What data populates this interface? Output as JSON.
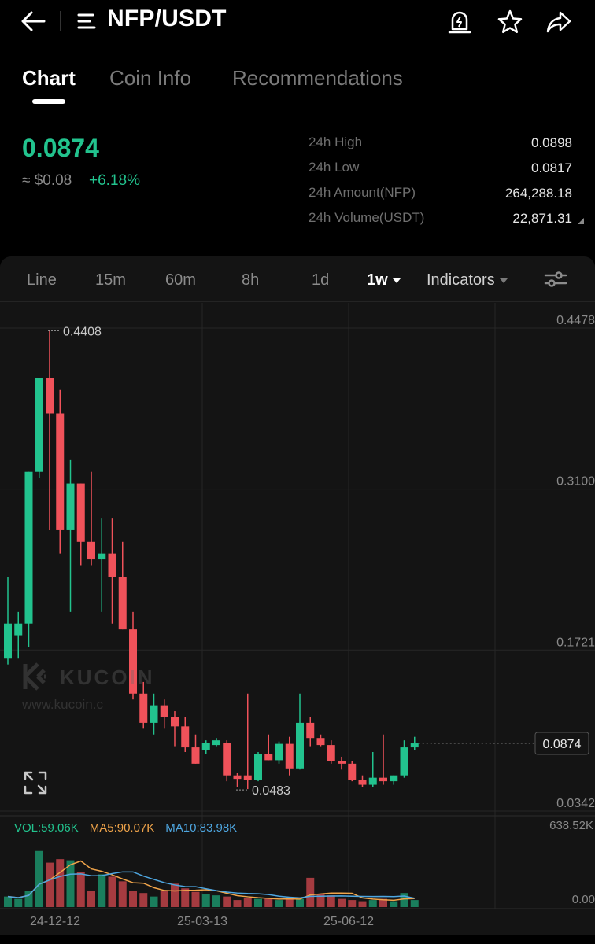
{
  "header": {
    "title": "NFP/USDT",
    "icons": [
      "back-arrow-icon",
      "menu-lines-icon",
      "price-alert-icon",
      "star-icon",
      "share-icon"
    ]
  },
  "tabs": [
    {
      "label": "Chart",
      "active": true
    },
    {
      "label": "Coin Info",
      "active": false
    },
    {
      "label": "Recommendations",
      "active": false
    }
  ],
  "ticker": {
    "last_price": "0.0874",
    "usd_approx": "≈ $0.08",
    "change_pct": "+6.18%",
    "stats": [
      {
        "label": "24h High",
        "value": "0.0898"
      },
      {
        "label": "24h Low",
        "value": "0.0817"
      },
      {
        "label": "24h Amount(NFP)",
        "value": "264,288.18"
      },
      {
        "label": "24h Volume(USDT)",
        "value": "22,871.31"
      }
    ]
  },
  "intervals": {
    "line": "Line",
    "m15": "15m",
    "m60": "60m",
    "h8": "8h",
    "d1": "1d",
    "w1": "1w",
    "indicators": "Indicators",
    "selected": "1w"
  },
  "colors": {
    "up": "#22c38e",
    "down": "#f0525a",
    "ma5": "#f0a44a",
    "ma10": "#4ea6e0",
    "background": "#141414"
  },
  "watermark": {
    "brand": "KUCOIN",
    "url": "www.kucoin.c"
  },
  "indicators": {
    "vol": "VOL:59.06K",
    "ma5": "MA5:90.07K",
    "ma10": "MA10:83.98K"
  },
  "chart_data": {
    "type": "candlestick",
    "y_axis_labels": [
      "0.4478",
      "0.3100",
      "0.1721",
      "0.0342"
    ],
    "y_ticks": [
      0.4478,
      0.31,
      0.1721,
      0.0342
    ],
    "volume_axis_labels": [
      "638.52K",
      "0.00"
    ],
    "x_axis_labels": [
      "24-12-12",
      "25-03-13",
      "25-06-12"
    ],
    "max_marker": "0.4408",
    "min_marker": "0.0483",
    "last_price_label": "0.0874",
    "last_price": 0.0874,
    "candles": [
      {
        "o": 0.16,
        "h": 0.23,
        "l": 0.155,
        "c": 0.19
      },
      {
        "o": 0.18,
        "h": 0.2,
        "l": 0.16,
        "c": 0.19
      },
      {
        "o": 0.19,
        "h": 0.29,
        "l": 0.17,
        "c": 0.32
      },
      {
        "o": 0.32,
        "h": 0.39,
        "l": 0.315,
        "c": 0.4
      },
      {
        "o": 0.4,
        "h": 0.4408,
        "l": 0.27,
        "c": 0.37
      },
      {
        "o": 0.37,
        "h": 0.39,
        "l": 0.25,
        "c": 0.27
      },
      {
        "o": 0.27,
        "h": 0.33,
        "l": 0.2,
        "c": 0.31
      },
      {
        "o": 0.31,
        "h": 0.31,
        "l": 0.24,
        "c": 0.26
      },
      {
        "o": 0.26,
        "h": 0.32,
        "l": 0.24,
        "c": 0.245
      },
      {
        "o": 0.245,
        "h": 0.28,
        "l": 0.2,
        "c": 0.25
      },
      {
        "o": 0.25,
        "h": 0.28,
        "l": 0.19,
        "c": 0.23
      },
      {
        "o": 0.23,
        "h": 0.26,
        "l": 0.19,
        "c": 0.185
      },
      {
        "o": 0.185,
        "h": 0.2,
        "l": 0.125,
        "c": 0.13
      },
      {
        "o": 0.13,
        "h": 0.14,
        "l": 0.1,
        "c": 0.105
      },
      {
        "o": 0.105,
        "h": 0.13,
        "l": 0.095,
        "c": 0.12
      },
      {
        "o": 0.12,
        "h": 0.125,
        "l": 0.1,
        "c": 0.11
      },
      {
        "o": 0.11,
        "h": 0.115,
        "l": 0.085,
        "c": 0.102
      },
      {
        "o": 0.102,
        "h": 0.11,
        "l": 0.08,
        "c": 0.084
      },
      {
        "o": 0.084,
        "h": 0.095,
        "l": 0.072,
        "c": 0.07
      },
      {
        "o": 0.082,
        "h": 0.09,
        "l": 0.078,
        "c": 0.088
      },
      {
        "o": 0.086,
        "h": 0.092,
        "l": 0.085,
        "c": 0.09
      },
      {
        "o": 0.088,
        "h": 0.09,
        "l": 0.055,
        "c": 0.06
      },
      {
        "o": 0.06,
        "h": 0.062,
        "l": 0.05,
        "c": 0.057
      },
      {
        "o": 0.06,
        "h": 0.13,
        "l": 0.0483,
        "c": 0.056
      },
      {
        "o": 0.056,
        "h": 0.08,
        "l": 0.055,
        "c": 0.078
      },
      {
        "o": 0.078,
        "h": 0.095,
        "l": 0.075,
        "c": 0.073
      },
      {
        "o": 0.073,
        "h": 0.089,
        "l": 0.07,
        "c": 0.087
      },
      {
        "o": 0.087,
        "h": 0.093,
        "l": 0.06,
        "c": 0.066
      },
      {
        "o": 0.066,
        "h": 0.13,
        "l": 0.065,
        "c": 0.105
      },
      {
        "o": 0.105,
        "h": 0.11,
        "l": 0.085,
        "c": 0.092
      },
      {
        "o": 0.092,
        "h": 0.095,
        "l": 0.085,
        "c": 0.086
      },
      {
        "o": 0.086,
        "h": 0.09,
        "l": 0.07,
        "c": 0.072
      },
      {
        "o": 0.072,
        "h": 0.076,
        "l": 0.065,
        "c": 0.07
      },
      {
        "o": 0.07,
        "h": 0.072,
        "l": 0.055,
        "c": 0.056
      },
      {
        "o": 0.056,
        "h": 0.06,
        "l": 0.05,
        "c": 0.052
      },
      {
        "o": 0.052,
        "h": 0.08,
        "l": 0.05,
        "c": 0.058
      },
      {
        "o": 0.058,
        "h": 0.095,
        "l": 0.052,
        "c": 0.055
      },
      {
        "o": 0.055,
        "h": 0.06,
        "l": 0.052,
        "c": 0.06
      },
      {
        "o": 0.06,
        "h": 0.09,
        "l": 0.058,
        "c": 0.084
      },
      {
        "o": 0.084,
        "h": 0.093,
        "l": 0.082,
        "c": 0.0874
      }
    ],
    "volumes": [
      0.09,
      0.07,
      0.14,
      0.48,
      0.38,
      0.41,
      0.4,
      0.3,
      0.14,
      0.28,
      0.26,
      0.22,
      0.14,
      0.12,
      0.09,
      0.14,
      0.2,
      0.16,
      0.13,
      0.11,
      0.1,
      0.09,
      0.06,
      0.08,
      0.07,
      0.07,
      0.06,
      0.07,
      0.07,
      0.25,
      0.11,
      0.1,
      0.07,
      0.06,
      0.05,
      0.06,
      0.07,
      0.05,
      0.12,
      0.06
    ],
    "volume_max": 0.64
  }
}
